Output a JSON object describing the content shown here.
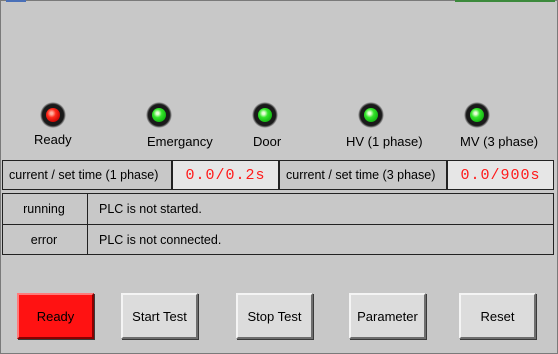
{
  "indicators": [
    {
      "label": "Ready",
      "state": "red"
    },
    {
      "label": "Emergancy",
      "state": "green"
    },
    {
      "label": "Door",
      "state": "green"
    },
    {
      "label": "HV (1 phase)",
      "state": "green"
    },
    {
      "label": "MV (3 phase)",
      "state": "green"
    }
  ],
  "timers": {
    "one_phase_label": "current / set time (1 phase)",
    "one_phase_value": "0.0/0.2s",
    "three_phase_label": "current / set time (3 phase)",
    "three_phase_value": "0.0/900s"
  },
  "status": {
    "running_label": "running",
    "running_value": "PLC is not started.",
    "error_label": "error",
    "error_value": "PLC is not connected."
  },
  "buttons": {
    "ready": "Ready",
    "start": "Start Test",
    "stop": "Stop Test",
    "parameter": "Parameter",
    "reset": "Reset"
  },
  "colors": {
    "background": "#c8c8c8",
    "value_text": "#ff1a1a",
    "active_button": "#ff1212",
    "lamp_red": "#ff2a1a",
    "lamp_green": "#34e52a"
  }
}
